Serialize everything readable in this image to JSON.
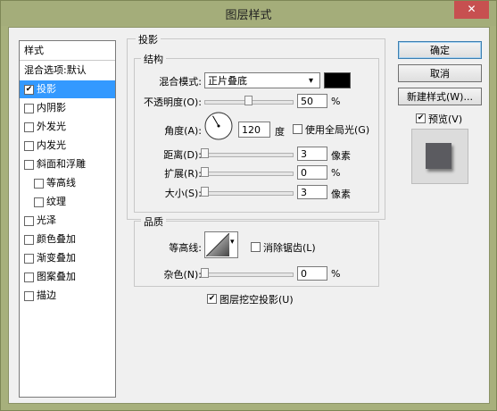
{
  "window": {
    "title": "图层样式",
    "close_glyph": "✕"
  },
  "sidebar": {
    "header": "样式",
    "items": [
      {
        "label": "混合选项:默认",
        "check": false,
        "checked": false,
        "indent": false,
        "selected": false
      },
      {
        "label": "投影",
        "check": true,
        "checked": true,
        "indent": false,
        "selected": true
      },
      {
        "label": "内阴影",
        "check": true,
        "checked": false,
        "indent": false,
        "selected": false
      },
      {
        "label": "外发光",
        "check": true,
        "checked": false,
        "indent": false,
        "selected": false
      },
      {
        "label": "内发光",
        "check": true,
        "checked": false,
        "indent": false,
        "selected": false
      },
      {
        "label": "斜面和浮雕",
        "check": true,
        "checked": false,
        "indent": false,
        "selected": false
      },
      {
        "label": "等高线",
        "check": true,
        "checked": false,
        "indent": true,
        "selected": false
      },
      {
        "label": "纹理",
        "check": true,
        "checked": false,
        "indent": true,
        "selected": false
      },
      {
        "label": "光泽",
        "check": true,
        "checked": false,
        "indent": false,
        "selected": false
      },
      {
        "label": "颜色叠加",
        "check": true,
        "checked": false,
        "indent": false,
        "selected": false
      },
      {
        "label": "渐变叠加",
        "check": true,
        "checked": false,
        "indent": false,
        "selected": false
      },
      {
        "label": "图案叠加",
        "check": true,
        "checked": false,
        "indent": false,
        "selected": false
      },
      {
        "label": "描边",
        "check": true,
        "checked": false,
        "indent": false,
        "selected": false
      }
    ]
  },
  "shadow": {
    "section_title": "投影",
    "structure": {
      "title": "结构",
      "blend_mode": {
        "label": "混合模式:",
        "value": "正片叠底",
        "color": "#000000"
      },
      "opacity": {
        "label": "不透明度(O):",
        "value": "50",
        "unit": "%",
        "slider_fraction": 0.5
      },
      "angle": {
        "label": "角度(A):",
        "value": "120",
        "unit": "度",
        "degrees": 120
      },
      "global_light": {
        "label": "使用全局光(G)",
        "checked": false
      },
      "distance": {
        "label": "距离(D):",
        "value": "3",
        "unit": "像素",
        "slider_fraction": 0.0
      },
      "spread": {
        "label": "扩展(R):",
        "value": "0",
        "unit": "%",
        "slider_fraction": 0.0
      },
      "size": {
        "label": "大小(S):",
        "value": "3",
        "unit": "像素",
        "slider_fraction": 0.0
      }
    },
    "quality": {
      "title": "品质",
      "contour": {
        "label": "等高线:"
      },
      "anti_alias": {
        "label": "消除锯齿(L)",
        "checked": false
      },
      "noise": {
        "label": "杂色(N):",
        "value": "0",
        "unit": "%",
        "slider_fraction": 0.0
      }
    },
    "knockout": {
      "label": "图层挖空投影(U)",
      "checked": true
    }
  },
  "buttons": {
    "ok": "确定",
    "cancel": "取消",
    "new_style": "新建样式(W)...",
    "preview": {
      "label": "预览(V)",
      "checked": true
    }
  },
  "colors": {
    "selection": "#3399ff",
    "preview_swatch": "#5b5b60",
    "shadow_color": "#000000"
  }
}
